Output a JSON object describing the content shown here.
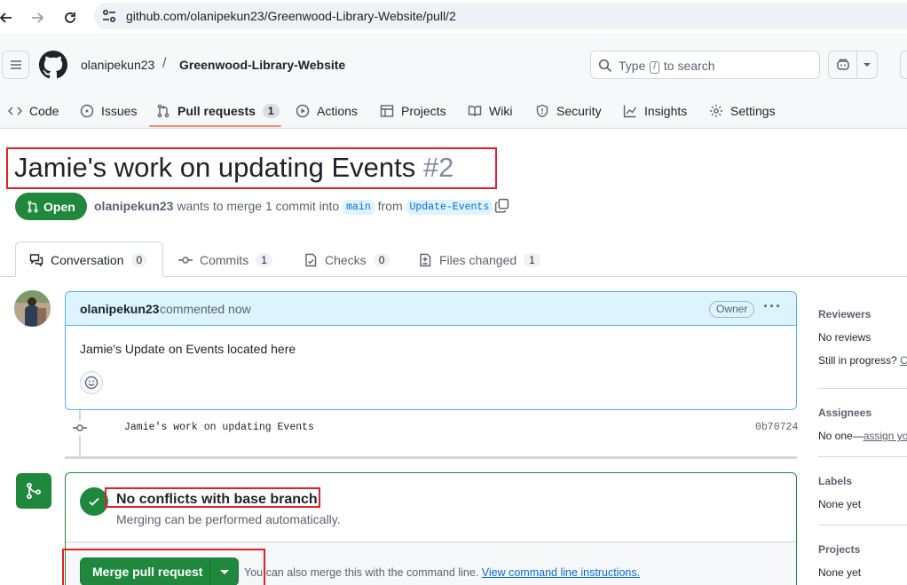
{
  "browser": {
    "url": "github.com/olanipekun23/Greenwood-Library-Website/pull/2"
  },
  "header": {
    "owner": "olanipekun23",
    "separator": "/",
    "repo": "Greenwood-Library-Website",
    "search_prefix": "Type",
    "search_key": "/",
    "search_suffix": "to search"
  },
  "repo_tabs": [
    {
      "label": "Code",
      "icon": "code-icon"
    },
    {
      "label": "Issues",
      "icon": "issue-opened-icon"
    },
    {
      "label": "Pull requests",
      "icon": "git-pull-request-icon",
      "count": "1",
      "active": true
    },
    {
      "label": "Actions",
      "icon": "play-icon"
    },
    {
      "label": "Projects",
      "icon": "table-icon"
    },
    {
      "label": "Wiki",
      "icon": "book-icon"
    },
    {
      "label": "Security",
      "icon": "shield-icon"
    },
    {
      "label": "Insights",
      "icon": "graph-icon"
    },
    {
      "label": "Settings",
      "icon": "gear-icon"
    }
  ],
  "pr": {
    "title": "Jamie's work on updating Events",
    "number": "#2",
    "state": "Open",
    "author": "olanipekun23",
    "merge_text": "wants to merge 1 commit into",
    "base_branch": "main",
    "from_text": "from",
    "head_branch": "Update-Events"
  },
  "pr_tabs": [
    {
      "label": "Conversation",
      "count": "0",
      "icon": "comment-discussion-icon",
      "active": true
    },
    {
      "label": "Commits",
      "count": "1",
      "icon": "git-commit-icon"
    },
    {
      "label": "Checks",
      "count": "0",
      "icon": "checklist-icon"
    },
    {
      "label": "Files changed",
      "count": "1",
      "icon": "file-diff-icon"
    }
  ],
  "comment": {
    "author": "olanipekun23",
    "when": "commented now",
    "badge": "Owner",
    "body": "Jamie's Update on Events located here"
  },
  "commit": {
    "message": "Jamie's work on updating Events",
    "sha": "0b70724"
  },
  "merge": {
    "title": "No conflicts with base branch",
    "subtitle": "Merging can be performed automatically.",
    "button": "Merge pull request",
    "cli_text": "You can also merge this with the command line.",
    "cli_link": "View command line instructions."
  },
  "sidebar": {
    "reviewers_heading": "Reviewers",
    "reviewers_value": "No reviews",
    "in_progress_text": "Still in progress?",
    "in_progress_link": "Co",
    "assignees_heading": "Assignees",
    "assignees_value": "No one—",
    "assignees_link": "assign yo",
    "labels_heading": "Labels",
    "labels_value": "None yet",
    "projects_heading": "Projects",
    "projects_value": "None yet"
  },
  "colors": {
    "open_green": "#1f883d",
    "link_blue": "#0969da",
    "highlight_red": "#e1202a",
    "tab_underline": "#fd8c73"
  }
}
